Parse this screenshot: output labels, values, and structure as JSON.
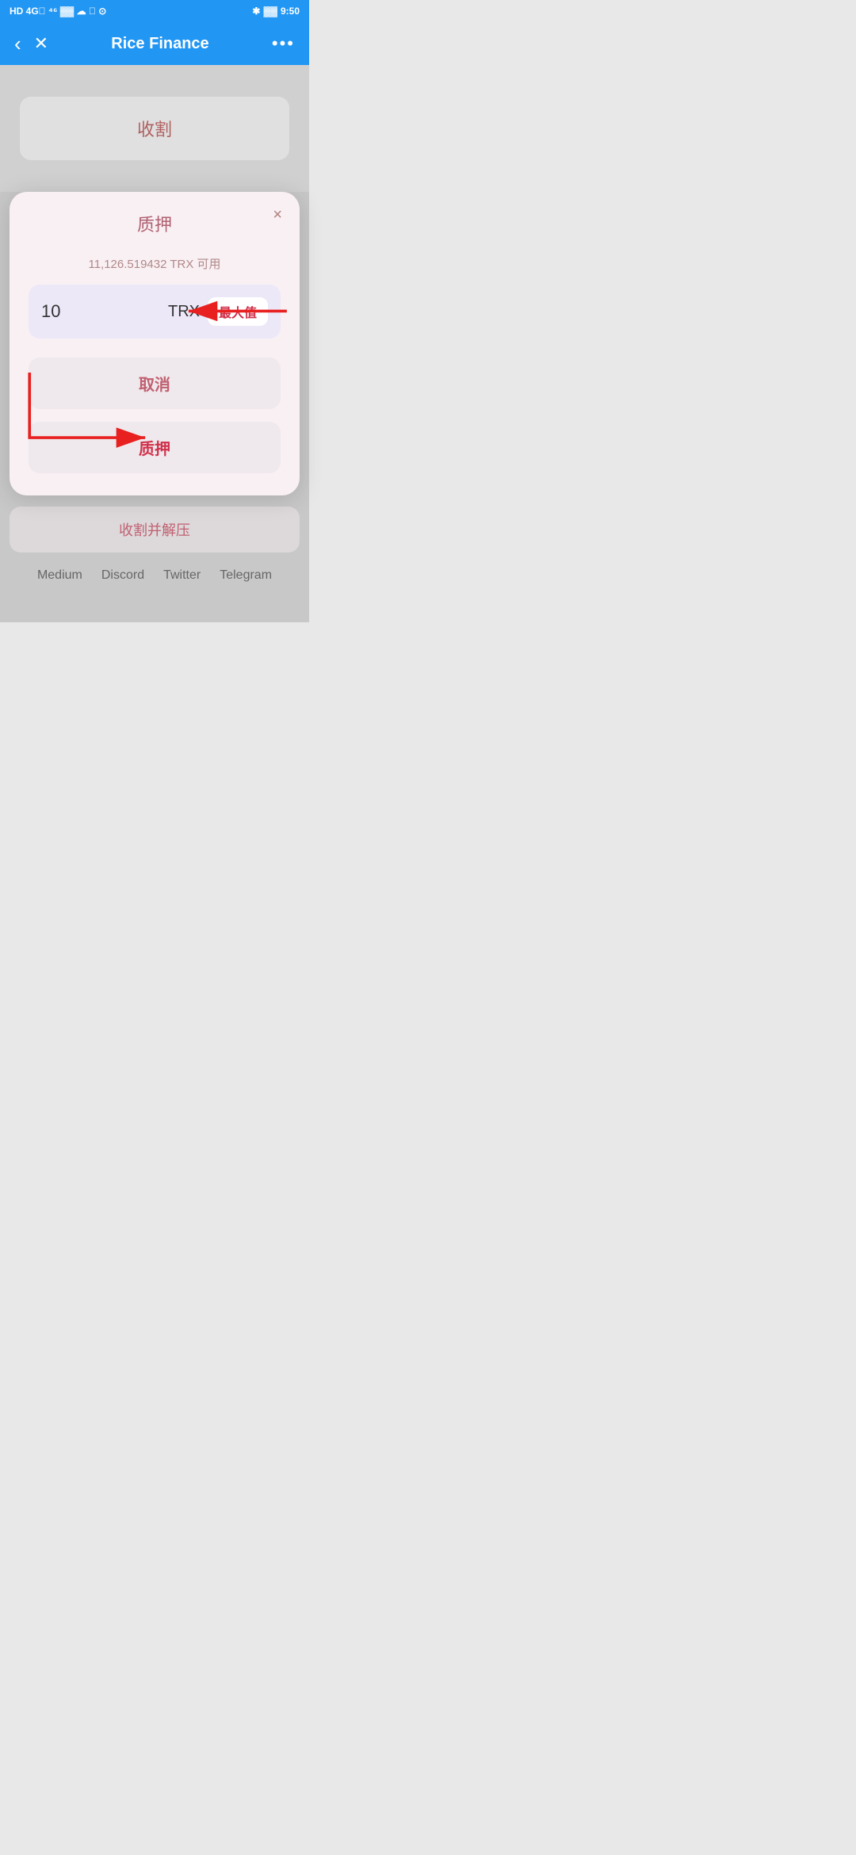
{
  "statusBar": {
    "leftIcons": "HD 4G",
    "time": "9:50"
  },
  "header": {
    "title": "Rice Finance",
    "backLabel": "‹",
    "closeLabel": "×",
    "menuLabel": "•••"
  },
  "bgCard": {
    "label": "收割"
  },
  "modal": {
    "title": "质押",
    "closeLabel": "×",
    "balance": "11,126.519432 TRX 可用",
    "inputValue": "10",
    "currency": "TRX",
    "maxLabel": "最大值",
    "cancelLabel": "取消",
    "confirmLabel": "质押"
  },
  "bottomCard": {
    "label": "收割并解压"
  },
  "footer": {
    "links": [
      "Medium",
      "Discord",
      "Twitter",
      "Telegram"
    ]
  }
}
